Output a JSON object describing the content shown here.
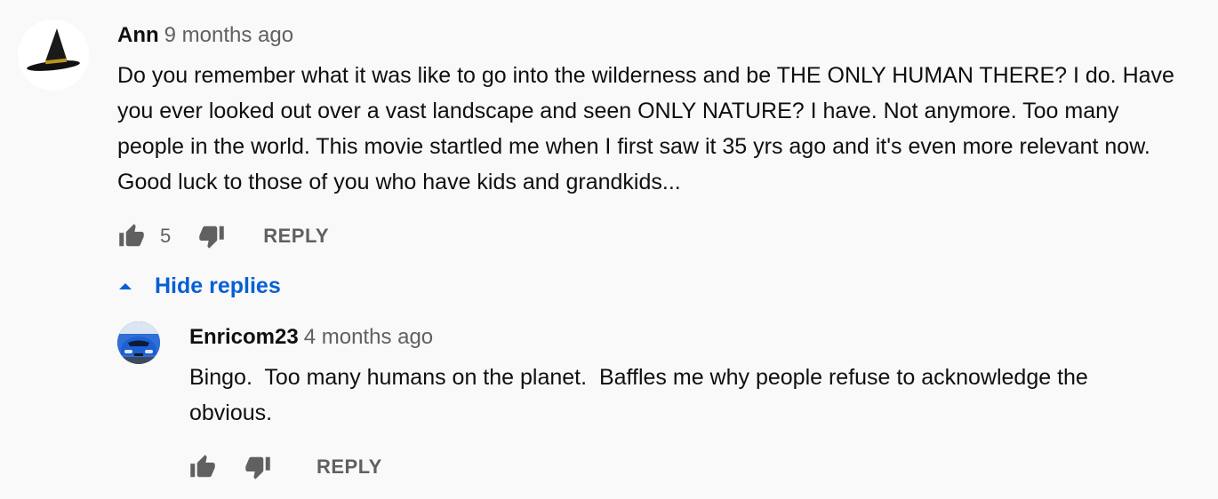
{
  "comment": {
    "author": "Ann",
    "time": "9 months ago",
    "text": "Do you remember what it was like to go into the wilderness and be THE ONLY HUMAN THERE? I do. Have you ever looked out over a vast landscape and seen ONLY NATURE? I have. Not anymore. Too many people in the world. This movie startled me when I first saw it 35 yrs ago and it's even more relevant now. Good luck to those of you who have kids and grandkids...",
    "like_count": "5",
    "reply_label": "REPLY",
    "like_icon": "thumbs-up-icon",
    "dislike_icon": "thumbs-down-icon"
  },
  "replies_toggle": {
    "label": "Hide replies",
    "icon": "caret-up-icon",
    "color": "#065fd4"
  },
  "reply": {
    "author": "Enricom23",
    "time": "4 months ago",
    "text": "Bingo.  Too many humans on the planet.  Baffles me why people refuse to acknowledge the obvious.",
    "reply_label": "REPLY",
    "like_icon": "thumbs-up-icon",
    "dislike_icon": "thumbs-down-icon"
  }
}
